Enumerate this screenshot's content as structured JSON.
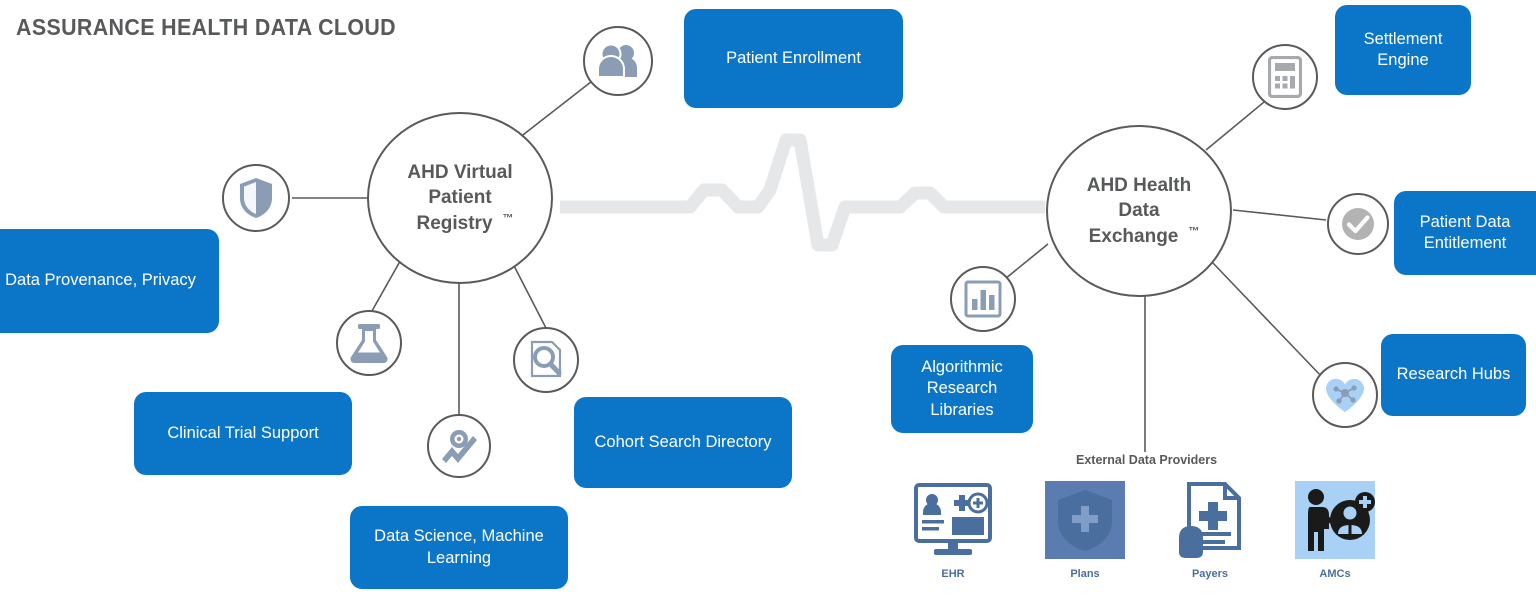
{
  "page": {
    "title": "ASSURANCE HEALTH DATA CLOUD",
    "accent_blue": "#0b76c8",
    "line_gray": "#5a5a5a",
    "text_gray": "#58595b",
    "icon_blue_gray": "#8b9cb5",
    "ecg_color": "#e8e8e8"
  },
  "hubs": {
    "left": {
      "line1": "AHD Virtual",
      "line2": "Patient",
      "line3": "Registry",
      "tm": "™"
    },
    "right": {
      "line1": "AHD Health",
      "line2": "Data",
      "line3": "Exchange",
      "tm": "™"
    }
  },
  "boxes": [
    {
      "id": "patient-enrollment",
      "label": "Patient Enrollment"
    },
    {
      "id": "data-provenance-privacy",
      "label": "Data Provenance, Privacy"
    },
    {
      "id": "clinical-trial-support",
      "label": "Clinical Trial Support"
    },
    {
      "id": "data-science-machine-learning",
      "label": "Data Science, Machine Learning"
    },
    {
      "id": "cohort-search-directory",
      "label": "Cohort Search Directory"
    },
    {
      "id": "algorithmic-research-libraries",
      "label": "Algorithmic Research Libraries"
    },
    {
      "id": "settlement-engine",
      "label": "Settlement Engine"
    },
    {
      "id": "patient-data-entitlement",
      "label": "Patient Data Entitlement"
    },
    {
      "id": "research-hubs",
      "label": "Research Hubs"
    }
  ],
  "icons": [
    {
      "id": "users-icon",
      "name": "users-icon",
      "for": "Patient Enrollment"
    },
    {
      "id": "shield-icon",
      "name": "shield-icon",
      "for": "Data Provenance, Privacy"
    },
    {
      "id": "flask-icon",
      "name": "flask-icon",
      "for": "Clinical Trial Support"
    },
    {
      "id": "analytics-icon",
      "name": "analytics-trend-icon",
      "for": "Data Science, Machine Learning"
    },
    {
      "id": "search-document-icon",
      "name": "search-document-icon",
      "for": "Cohort Search Directory"
    },
    {
      "id": "bar-chart-icon",
      "name": "bar-chart-icon",
      "for": "Algorithmic Research Libraries"
    },
    {
      "id": "calculator-icon",
      "name": "calculator-icon",
      "for": "Settlement Engine"
    },
    {
      "id": "check-circle-icon",
      "name": "check-circle-icon",
      "for": "Patient Data Entitlement"
    },
    {
      "id": "heart-network-icon",
      "name": "heart-network-icon",
      "for": "Research Hubs"
    }
  ],
  "providers": {
    "title": "External Data Providers",
    "items": [
      {
        "id": "ehr",
        "label": "EHR",
        "icon": "monitor-dashboard-icon"
      },
      {
        "id": "plans",
        "label": "Plans",
        "icon": "shield-plus-icon"
      },
      {
        "id": "payers",
        "label": "Payers",
        "icon": "claim-document-icon"
      },
      {
        "id": "amcs",
        "label": "AMCs",
        "icon": "clinician-patient-icon"
      }
    ]
  }
}
